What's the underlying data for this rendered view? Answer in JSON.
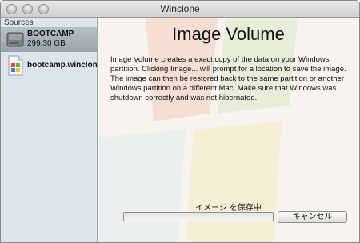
{
  "window": {
    "title": "Winclone"
  },
  "sidebar": {
    "header": "Sources",
    "items": [
      {
        "name": "BOOTCAMP",
        "size": "299.30 GB",
        "icon": "hard-disk-icon"
      },
      {
        "name": "bootcamp.winclone",
        "icon": "winclone-document-icon"
      }
    ]
  },
  "main": {
    "title": "Image Volume",
    "description": "Image Volume creates a exact copy of the data on your Windows partition.  Clicking Image... will prompt for a location to save the image.  The image can then be restored back to the same partition or another Windows partition on a different Mac.  Make sure that Windows was shutdown correctly and was not hibernated.",
    "status": "イメージ を保存中",
    "progress": 0,
    "cancel_label": "キャンセル"
  },
  "colors": {
    "sidebar_bg": "#dde4ec",
    "selection": "#a9b0ba",
    "progress_fill": "#6f93d8"
  }
}
